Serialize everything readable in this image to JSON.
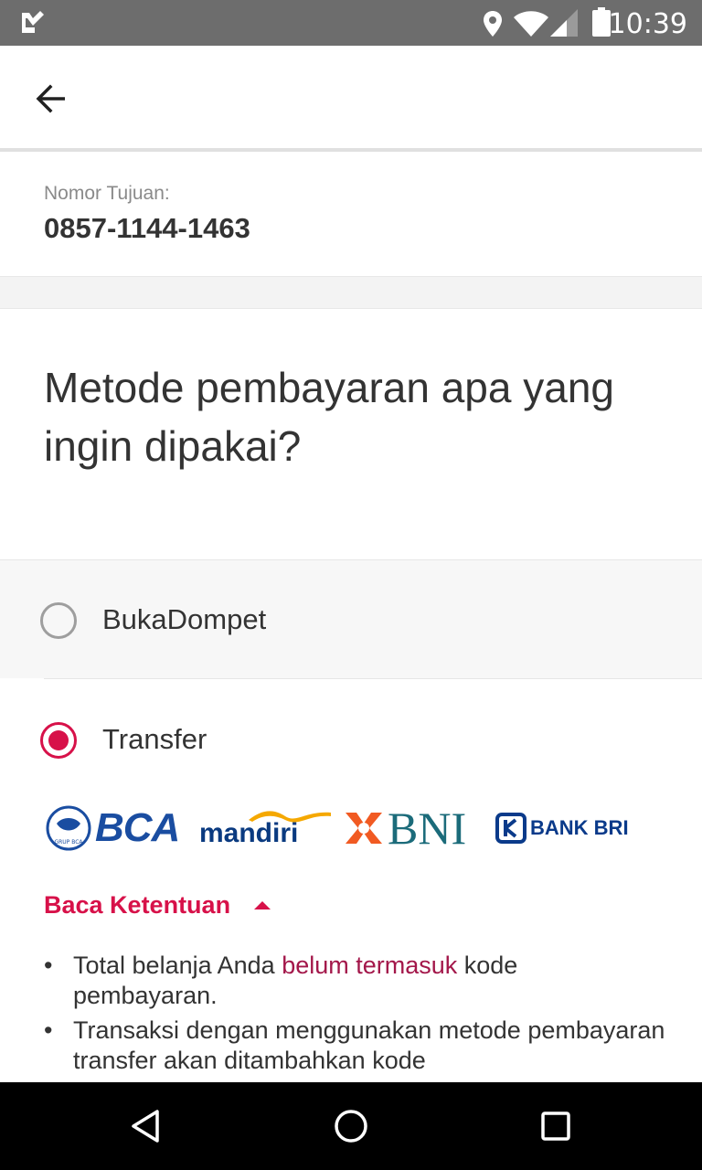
{
  "status_bar": {
    "time": "10:39",
    "icons": [
      "app-check-icon",
      "location-icon",
      "wifi-icon",
      "signal-icon",
      "battery-icon"
    ]
  },
  "app_bar": {
    "back_icon": "arrow-left-icon"
  },
  "destination": {
    "label": "Nomor Tujuan:",
    "value": "0857-1144-1463"
  },
  "question": "Metode pembayaran apa yang ingin dipakai?",
  "options": [
    {
      "label": "BukaDompet",
      "selected": false
    },
    {
      "label": "Transfer",
      "selected": true
    }
  ],
  "banks": [
    {
      "name": "BCA",
      "sub": "GRUP BCA"
    },
    {
      "name": "mandiri"
    },
    {
      "name": "BNI"
    },
    {
      "name": "BANK BRI"
    }
  ],
  "terms": {
    "toggle_label": "Baca Ketentuan",
    "items": [
      {
        "before": "Total belanja Anda ",
        "highlight": "belum termasuk",
        "after": " kode pembayaran."
      },
      {
        "text": "Transaksi dengan menggunakan metode pembayaran transfer akan ditambahkan kode"
      }
    ]
  },
  "colors": {
    "accent": "#d71149",
    "highlight": "#a3174a",
    "status_bar": "#6d6d6d"
  },
  "nav_bar": {
    "icons": [
      "back-triangle-icon",
      "home-circle-icon",
      "recents-square-icon"
    ]
  }
}
